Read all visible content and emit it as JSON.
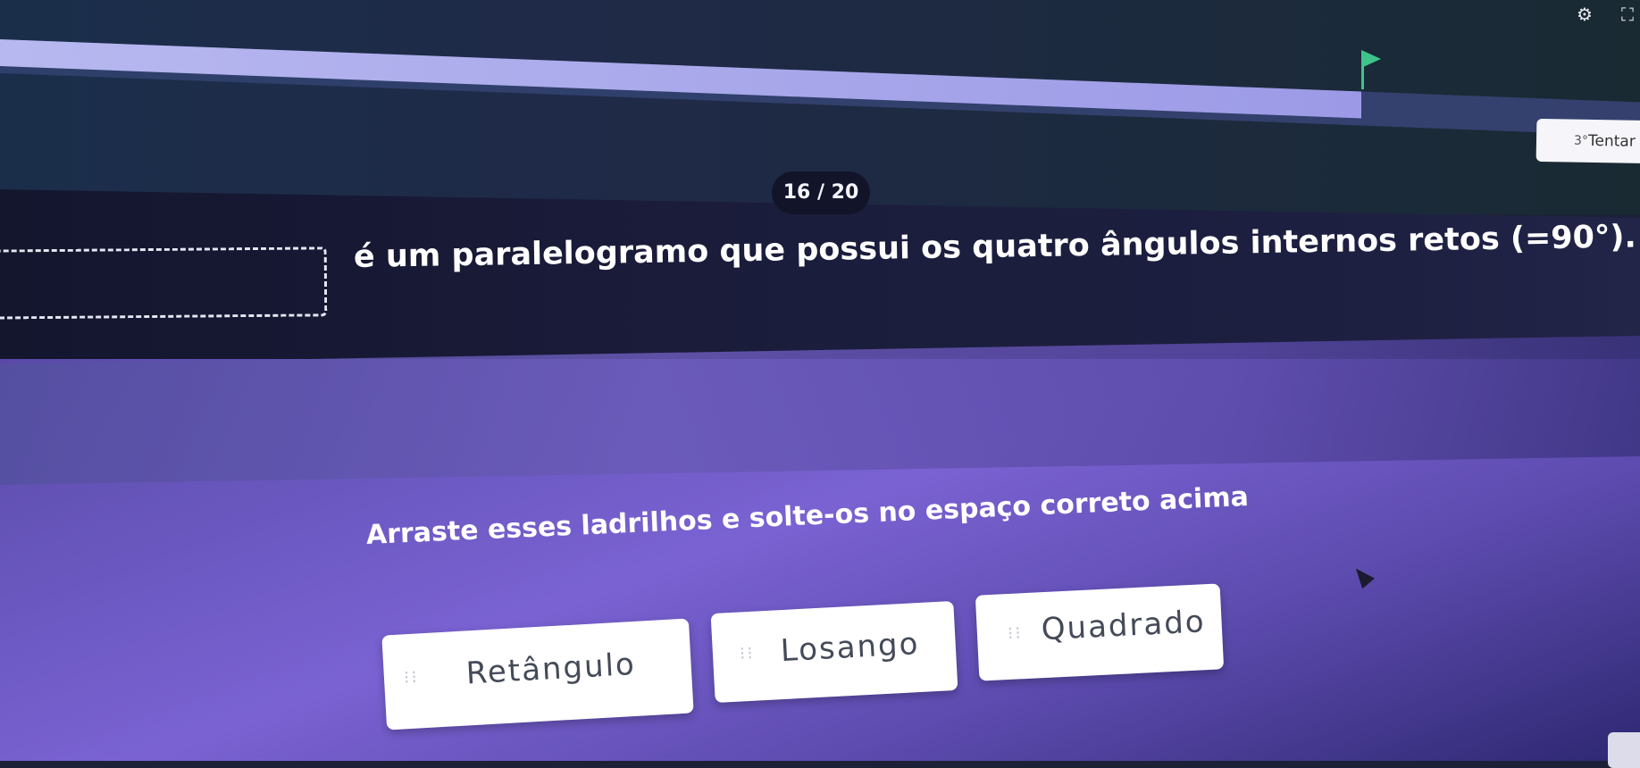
{
  "header": {
    "progress_fraction": 0.83,
    "icons": [
      "gear-icon",
      "fullscreen-icon"
    ],
    "retry_icon": "retry-icon",
    "retry_label": "Tentar",
    "retry_prefix": "3°"
  },
  "question": {
    "counter": "16 / 20",
    "text": "é um paralelogramo que possui os quatro ângulos internos retos (=90°)."
  },
  "answers": {
    "instruction": "Arraste esses ladrilhos e solte-os no espaço correto acima",
    "tiles": [
      {
        "label": "Retângulo"
      },
      {
        "label": "Losango"
      },
      {
        "label": "Quadrado"
      }
    ]
  },
  "colors": {
    "accent": "#3ec48b",
    "progress": "#b8b8f0",
    "answer_bg": "#6a58c0"
  }
}
